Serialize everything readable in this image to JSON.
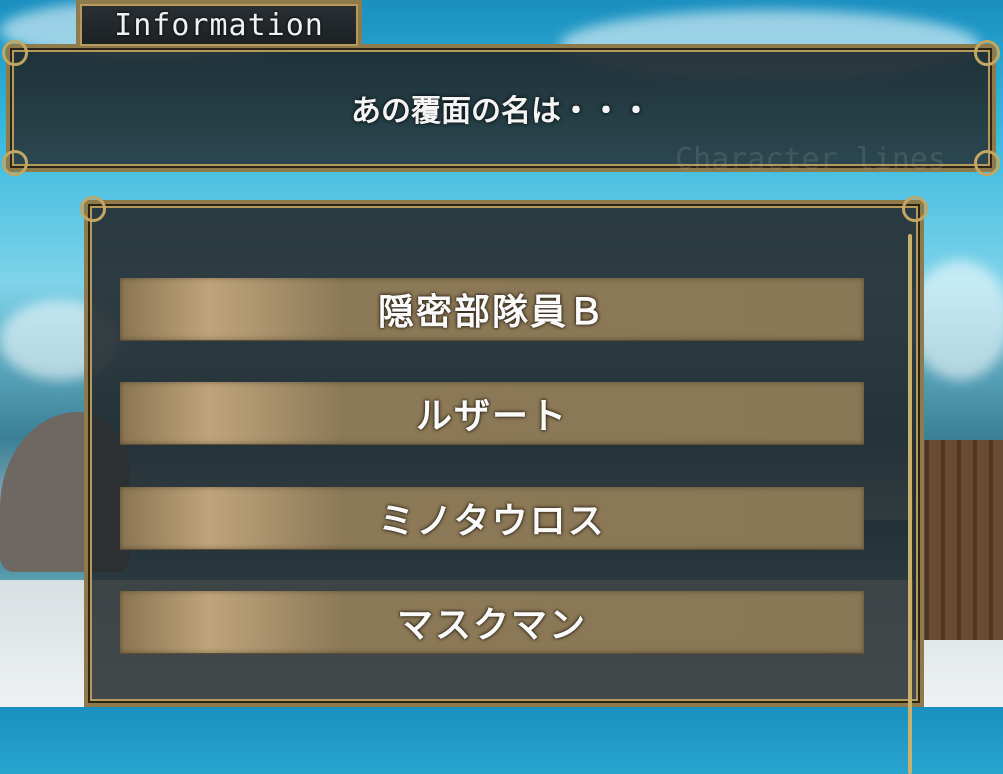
{
  "info": {
    "tab_label": "Information",
    "message": "あの覆面の名は・・・",
    "watermark": "Character lines"
  },
  "choices": [
    {
      "label": "隠密部隊員Ｂ"
    },
    {
      "label": "ルザート"
    },
    {
      "label": "ミノタウロス"
    },
    {
      "label": "マスクマン"
    }
  ],
  "colors": {
    "frame_gold": "#8e7a4a",
    "button_tan": "#8a7756",
    "text": "#f4f4f4"
  }
}
